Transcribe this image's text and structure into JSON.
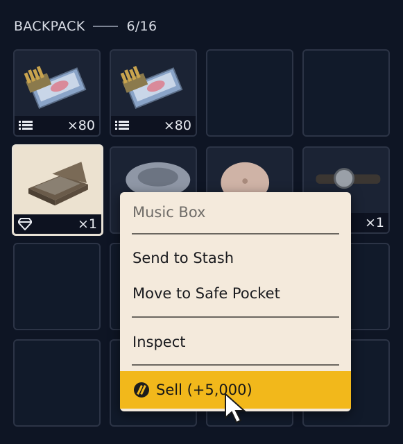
{
  "inventory": {
    "title": "BACKPACK",
    "capacity": "6/16",
    "slots": [
      {
        "item": "Ammo box",
        "qty": "×80",
        "badge_icon": "list-icon"
      },
      {
        "item": "Ammo box",
        "qty": "×80",
        "badge_icon": "list-icon"
      },
      {
        "item": null
      },
      {
        "item": null
      },
      {
        "item": "Music Box",
        "qty": "×1",
        "badge_icon": "diamond-icon",
        "selected": true
      },
      {
        "item": "Round cushion",
        "qty": ""
      },
      {
        "item": "Pillow",
        "qty": ""
      },
      {
        "item": "Wristwatch",
        "qty": "×1"
      }
    ]
  },
  "context_menu": {
    "title": "Music Box",
    "items": [
      "Send to Stash",
      "Move to Safe Pocket",
      "Inspect"
    ],
    "sell_label": "Sell (+5,000)",
    "sell_icon": "coin-icon"
  },
  "colors": {
    "background": "#0e1524",
    "menu_bg": "#f4eadc",
    "sell_accent": "#f2b81b"
  }
}
